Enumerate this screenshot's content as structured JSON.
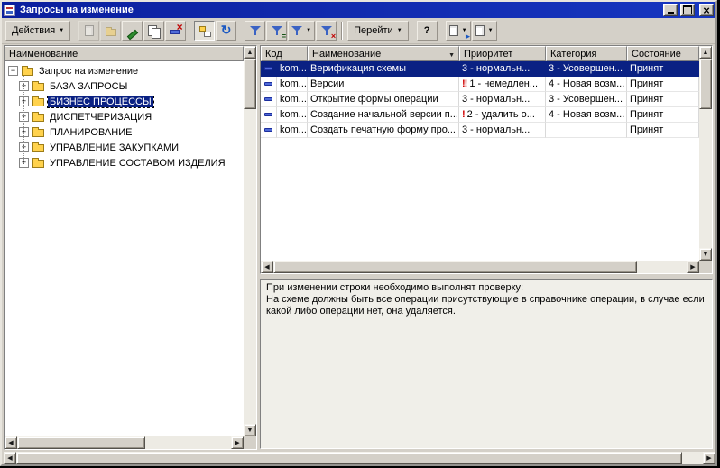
{
  "window": {
    "title": "Запросы на изменение"
  },
  "toolbar": {
    "actions_label": "Действия",
    "goto_label": "Перейти",
    "help_label": "?",
    "icons": [
      "add-icon",
      "add-group-icon",
      "edit-icon",
      "copy-icon",
      "mark-deletion-icon",
      "hierarchy-icon",
      "refresh-icon",
      "filter-sort-icon",
      "filter-by-value-icon",
      "filter-history-icon",
      "clear-filter-icon",
      "output-list-icon",
      "list-settings-icon"
    ]
  },
  "tree_panel": {
    "header": "Наименование",
    "root_label": "Запрос на изменение",
    "items": [
      "БАЗА ЗАПРОСЫ",
      "БИЗНЕС ПРОЦЕССЫ",
      "ДИСПЕТЧЕРИЗАЦИЯ",
      "ПЛАНИРОВАНИЕ",
      "УПРАВЛЕНИЕ ЗАКУПКАМИ",
      "УПРАВЛЕНИЕ СОСТАВОМ ИЗДЕЛИЯ"
    ],
    "selected_item": "БИЗНЕС ПРОЦЕССЫ"
  },
  "table": {
    "columns": {
      "code": "Код",
      "name": "Наименование",
      "priority": "Приоритет",
      "category": "Категория",
      "state": "Состояние"
    },
    "sorted_by": "Наименование",
    "rows": [
      {
        "code": "kom...",
        "name": "Верификация схемы",
        "urgency": "",
        "priority": "3 - нормальн...",
        "category": "3 - Усовершен...",
        "state": "Принят",
        "selected": true
      },
      {
        "code": "kom...",
        "name": "Версии",
        "urgency": "!!",
        "priority": "1 - немедлен...",
        "category": "4 - Новая возм...",
        "state": "Принят"
      },
      {
        "code": "kom...",
        "name": "Открытие формы операции",
        "urgency": "",
        "priority": "3 - нормальн...",
        "category": "3 - Усовершен...",
        "state": "Принят"
      },
      {
        "code": "kom...",
        "name": "Создание начальной версии п...",
        "urgency": "!",
        "priority": "2 - удалить о...",
        "category": "4 - Новая возм...",
        "state": "Принят"
      },
      {
        "code": "kom...",
        "name": "Создать печатную форму про...",
        "urgency": "",
        "priority": "3 - нормальн...",
        "category": "",
        "state": "Принят"
      }
    ]
  },
  "description": {
    "line1": "При изменении строки необходимо выполнят проверку:",
    "line2": "На схеме должны быть все операции присутствующие в справочнике операции, в случае если какой либо операции нет, она удаляется."
  },
  "colors": {
    "titlebar": "#0b1f9e",
    "selection": "#0a2183",
    "window_bg": "#d4d0c8",
    "urgent_red": "#d00000",
    "item_icon_blue": "#4f6bd8",
    "folder_yellow": "#ffd24d"
  }
}
